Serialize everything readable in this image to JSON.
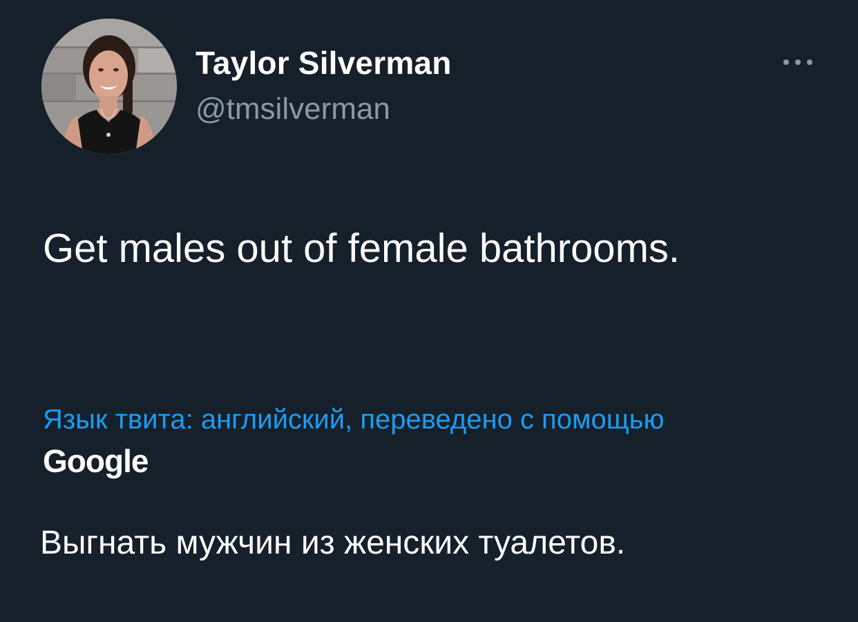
{
  "author": {
    "display_name": "Taylor Silverman",
    "handle": "@tmsilverman"
  },
  "tweet": {
    "text": "Get males out of female bathrooms."
  },
  "translation": {
    "note": "Язык твита: английский, переведено с помощью",
    "provider": "Google",
    "text": "Выгнать мужчин из женских туалетов."
  },
  "colors": {
    "background": "#15202b",
    "accent": "#1d9bf0",
    "secondary_text": "#8b98a5"
  },
  "icons": {
    "menu": "more-horizontal-icon"
  }
}
